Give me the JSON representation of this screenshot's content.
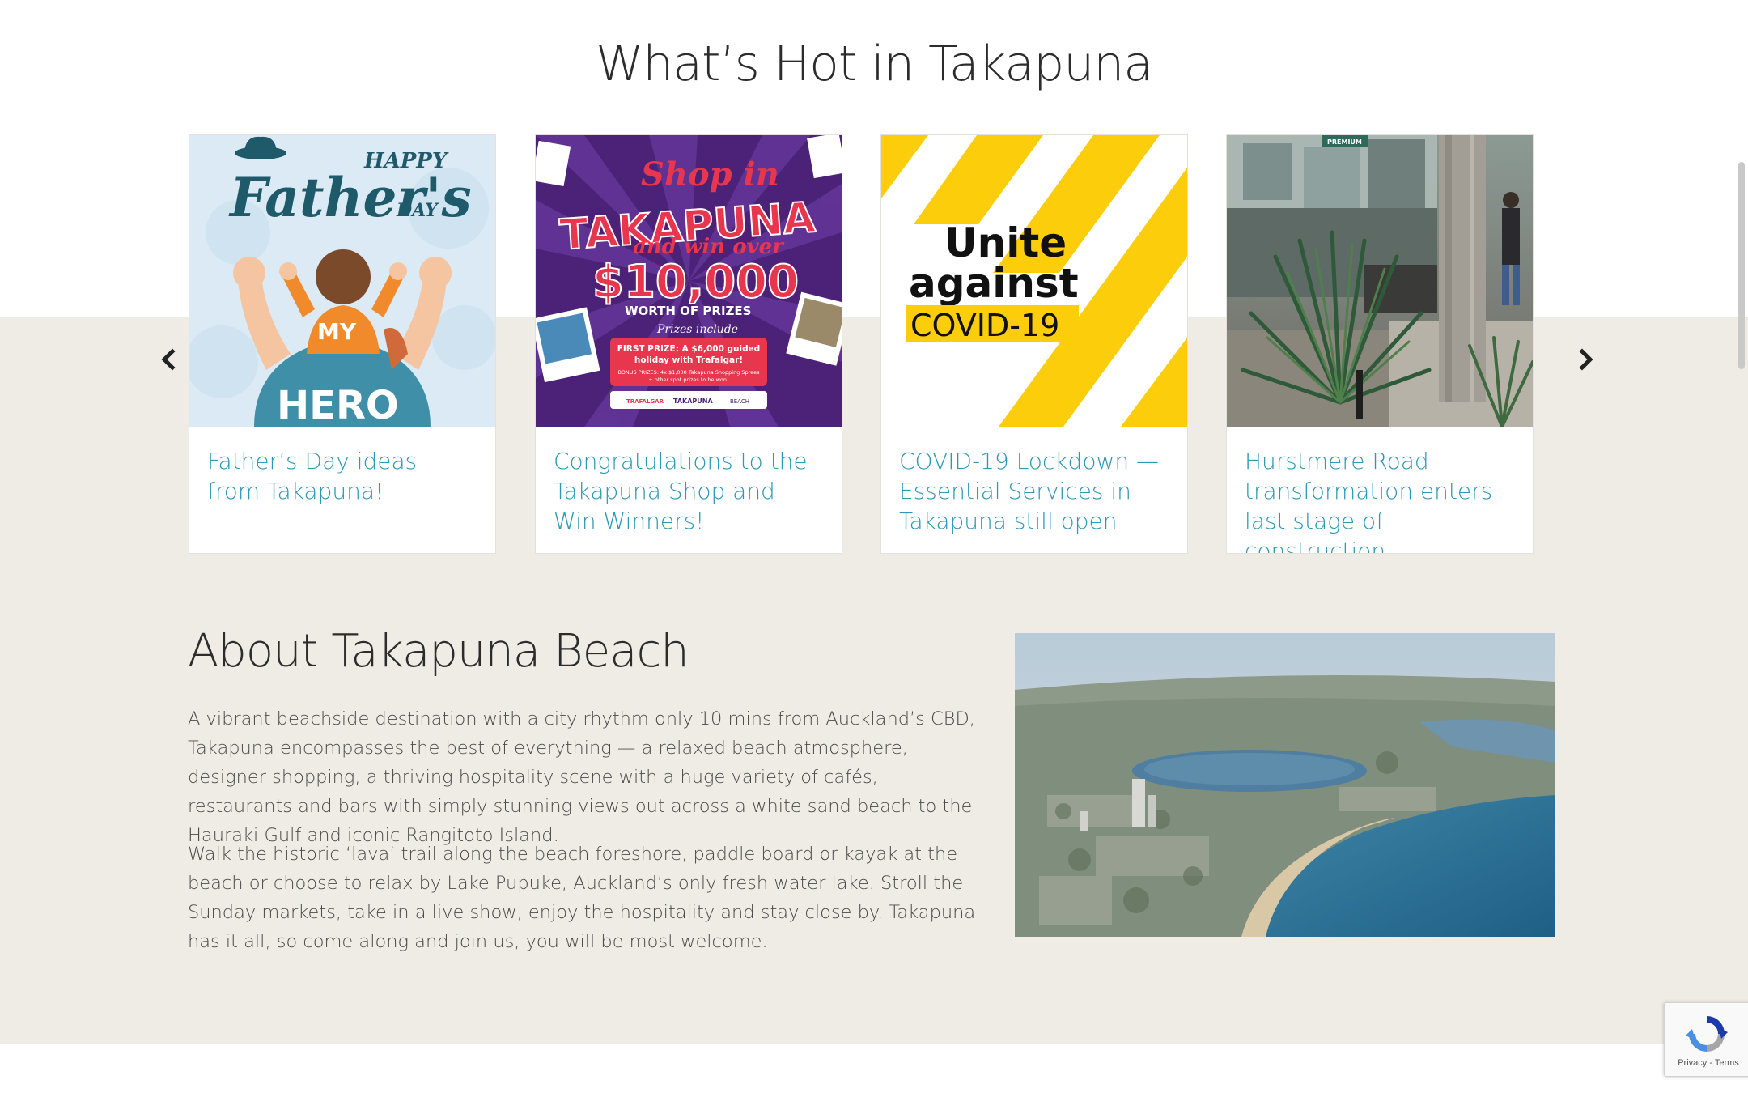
{
  "hot_section": {
    "title": "What’s Hot in Takapuna"
  },
  "carousel": {
    "prev_icon": "chevron-left-icon",
    "next_icon": "chevron-right-icon",
    "cards": [
      {
        "title": "Father’s Day ideas from Takapuna!",
        "image_text": {
          "happy": "HAPPY",
          "fathers": "Father's",
          "day": "DAY",
          "my": "MY",
          "hero": "HERO"
        }
      },
      {
        "title": "Congratulations to the Takapuna Shop and Win Winners!",
        "image_text": {
          "shop_in": "Shop in",
          "takapuna": "TAKAPUNA",
          "and_win_over": "and win over",
          "amount": "$10,000",
          "worth": "WORTH OF PRIZES",
          "prizes_include": "Prizes include",
          "first_prize": "FIRST PRIZE: A $6,000 guided",
          "holiday": "holiday with Trafalgar!",
          "bonus": "BONUS PRIZES: 4x $1,000 Takapuna Shopping Sprees",
          "other": "+ other spot prizes to be won!",
          "logo1": "TRAFALGAR",
          "logo2": "TAKAPUNA",
          "logo3": "BEACH"
        }
      },
      {
        "title": "COVID-19 Lockdown — Essential Services in Takapuna still open",
        "image_text": {
          "line1": "Unite",
          "line2": "against",
          "line3": "COVID-19"
        }
      },
      {
        "title": "Hurstmere Road transformation enters last stage of construction",
        "image_text": {
          "sign": "PREMIUM"
        }
      }
    ]
  },
  "about": {
    "title": "About Takapuna Beach",
    "paragraph1": "A vibrant beachside destination with a city rhythm only 10 mins from Auckland’s CBD, Takapuna encompasses the best of everything — a relaxed beach atmosphere, designer shopping, a thriving hospitality scene with a huge variety of cafés, restaurants and bars with simply stunning views out across a white sand beach to the Hauraki Gulf and iconic Rangitoto Island.",
    "paragraph2": "Walk the historic ‘lava’ trail along the beach foreshore, paddle board or kayak at the beach or choose to relax by Lake Pupuke, Auckland’s only fresh water lake. Stroll the Sunday markets, take in a live show, enjoy the hospitality and stay close by. Takapuna has it all, so come along and join us, you will be most welcome."
  },
  "recaptcha": {
    "privacy": "Privacy",
    "separator": " - ",
    "terms": "Terms"
  },
  "colors": {
    "link": "#2b98b5",
    "band": "#efece5",
    "covid_yellow": "#fccd0a",
    "purple": "#5a2a8a"
  }
}
